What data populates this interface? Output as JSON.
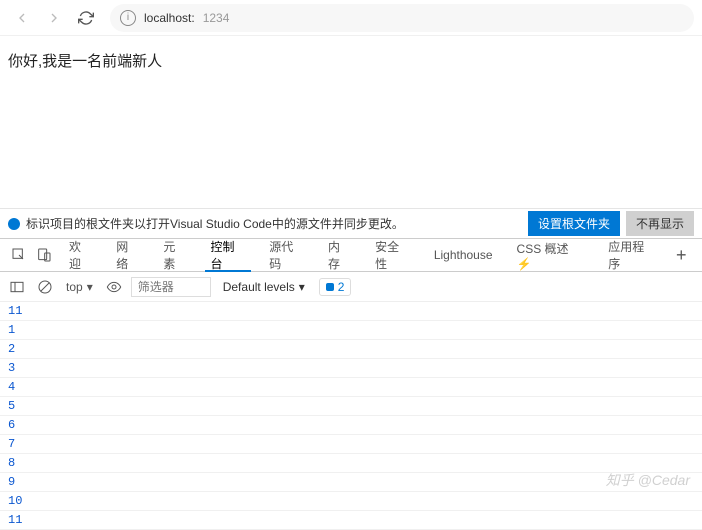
{
  "address": {
    "host": "localhost:",
    "port": "1234"
  },
  "page": {
    "content": "你好,我是一名前端新人"
  },
  "notice": {
    "text": "标识项目的根文件夹以打开Visual Studio Code中的源文件并同步更改。",
    "primary": "设置根文件夹",
    "secondary": "不再显示"
  },
  "tabs": [
    "欢迎",
    "网络",
    "元素",
    "控制台",
    "源代码",
    "内存",
    "安全性",
    "Lighthouse",
    "CSS 概述 ⚡",
    "应用程序"
  ],
  "activeTab": 3,
  "consoleBar": {
    "context": "top",
    "filterPlaceholder": "筛选器",
    "levels": "Default levels",
    "issueCount": "2"
  },
  "consoleLines": [
    "11",
    "1",
    "2",
    "3",
    "4",
    "5",
    "6",
    "7",
    "8",
    "9",
    "10",
    "11"
  ],
  "watermark": "知乎 @Cedar"
}
